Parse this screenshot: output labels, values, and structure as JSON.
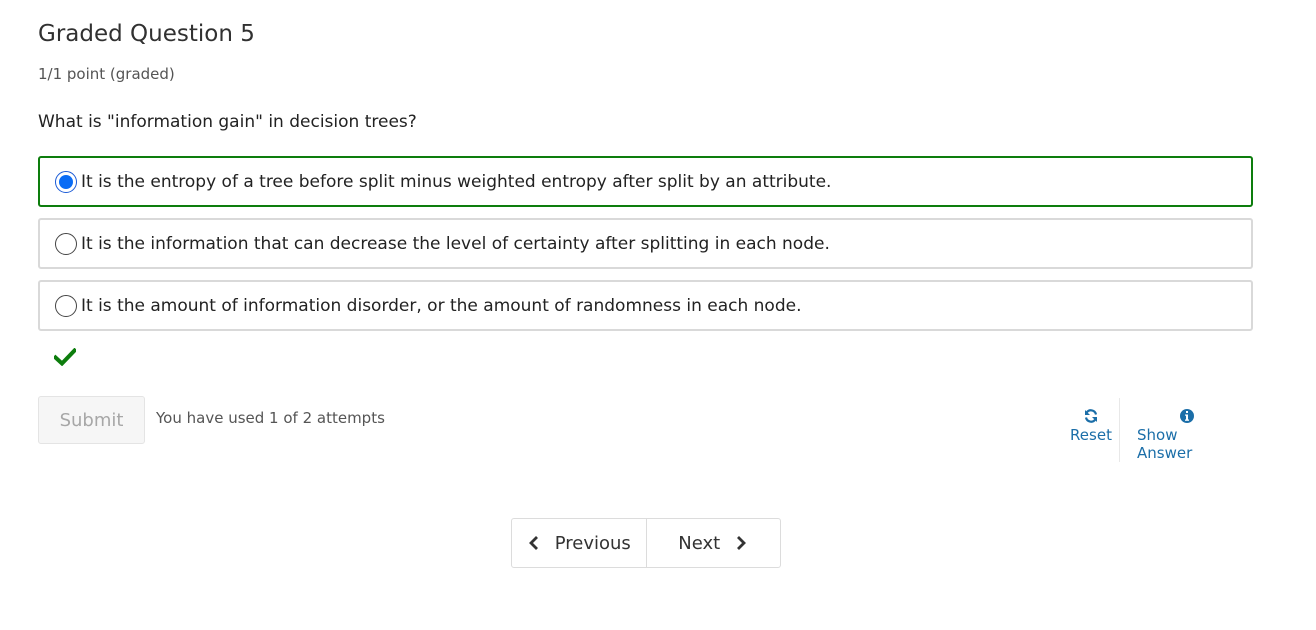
{
  "problem": {
    "title": "Graded Question 5",
    "points": "1/1 point (graded)",
    "question": "What is \"information gain\" in decision trees?",
    "choices": [
      {
        "label": "It is the entropy of a tree before split minus weighted entropy after split by an attribute.",
        "selected": true,
        "correct": true
      },
      {
        "label": "It is the information that can decrease the level of certainty after splitting in each node.",
        "selected": false,
        "correct": false
      },
      {
        "label": "It is the amount of information disorder, or the amount of randomness in each node.",
        "selected": false,
        "correct": false
      }
    ],
    "status_icon": "checkmark-icon"
  },
  "actions": {
    "submit_label": "Submit",
    "attempts_text": "You have used 1 of 2 attempts",
    "reset_label": "Reset",
    "reset_icon": "refresh-icon",
    "show_answer_label": "Show Answer",
    "show_answer_icon": "info-circle-icon"
  },
  "navigation": {
    "previous_label": "Previous",
    "next_label": "Next"
  },
  "colors": {
    "correct_border": "#0d7d0d",
    "link": "#1b6ea8",
    "radio_selected": "#0a6cf5"
  }
}
